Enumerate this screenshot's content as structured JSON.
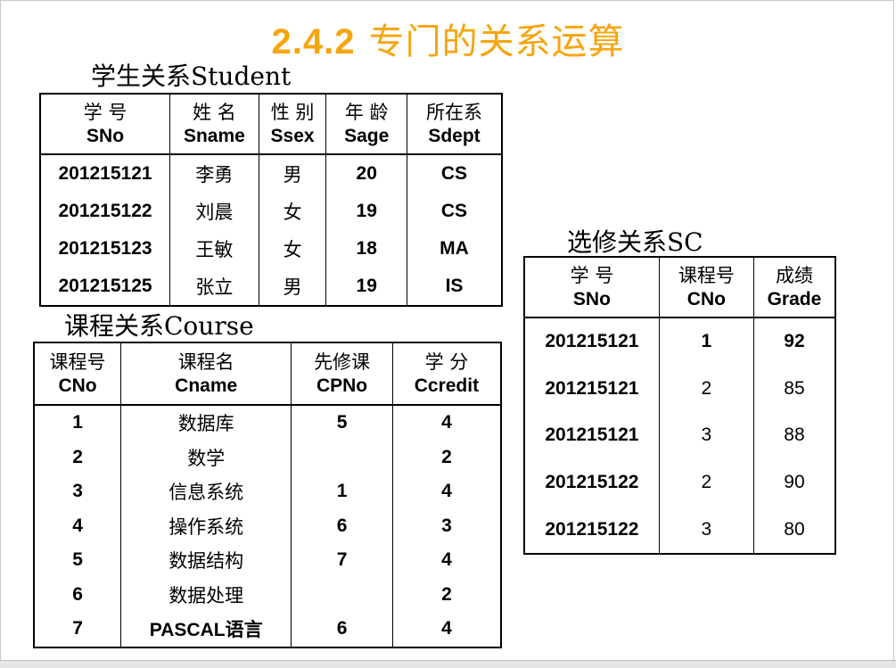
{
  "title": {
    "number": "2.4.2",
    "text": "专门的关系运算"
  },
  "student": {
    "caption": "学生关系Student",
    "headers": [
      {
        "cn": "学 号",
        "en": "SNo"
      },
      {
        "cn": "姓 名",
        "en": "Sname"
      },
      {
        "cn": "性 别",
        "en": "Ssex"
      },
      {
        "cn": "年 龄",
        "en": "Sage"
      },
      {
        "cn": "所在系",
        "en": "Sdept"
      }
    ],
    "rows": [
      [
        "201215121",
        "李勇",
        "男",
        "20",
        "CS"
      ],
      [
        "201215122",
        "刘晨",
        "女",
        "19",
        "CS"
      ],
      [
        "201215123",
        "王敏",
        "女",
        "18",
        "MA"
      ],
      [
        "201215125",
        "张立",
        "男",
        "19",
        "IS"
      ]
    ]
  },
  "course": {
    "caption": "课程关系Course",
    "headers": [
      {
        "cn": "课程号",
        "en": "CNo"
      },
      {
        "cn": "课程名",
        "en": "Cname"
      },
      {
        "cn": "先修课",
        "en": "CPNo"
      },
      {
        "cn": "学 分",
        "en": "Ccredit"
      }
    ],
    "rows": [
      [
        "1",
        "数据库",
        "5",
        "4"
      ],
      [
        "2",
        "数学",
        "",
        "2"
      ],
      [
        "3",
        "信息系统",
        "1",
        "4"
      ],
      [
        "4",
        "操作系统",
        "6",
        "3"
      ],
      [
        "5",
        "数据结构",
        "7",
        "4"
      ],
      [
        "6",
        "数据处理",
        "",
        "2"
      ],
      [
        "7",
        "PASCAL语言",
        "6",
        "4"
      ]
    ]
  },
  "sc": {
    "caption": "选修关系SC",
    "headers": [
      {
        "cn": "学 号",
        "en": "SNo"
      },
      {
        "cn": "课程号",
        "en": "CNo"
      },
      {
        "cn": "成绩",
        "en": "Grade"
      }
    ],
    "rows": [
      [
        "201215121",
        "1",
        "92"
      ],
      [
        "201215121",
        "2",
        "85"
      ],
      [
        "201215121",
        "3",
        "88"
      ],
      [
        "201215122",
        "2",
        "90"
      ],
      [
        "201215122",
        "3",
        "80"
      ]
    ]
  },
  "colors": {
    "title": "#f7a50c",
    "text": "#000000",
    "border": "#000000"
  }
}
